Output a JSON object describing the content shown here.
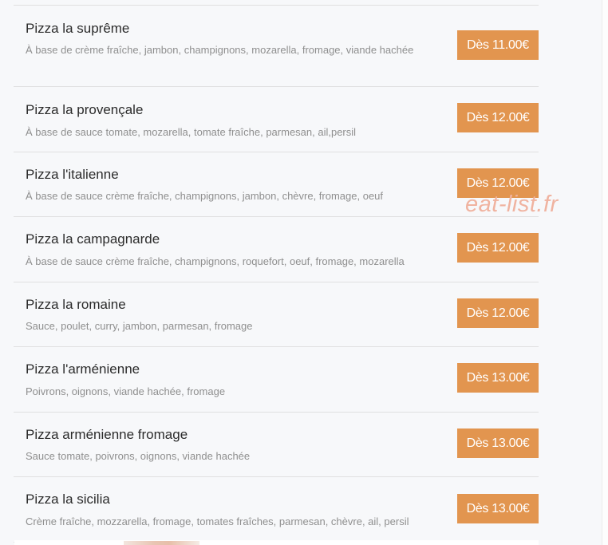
{
  "menu": {
    "items": [
      {
        "name": "Pizza la suprême",
        "description": "À base de crème fraîche, jambon, champignons, mozarella, fromage, viande hachée",
        "price": "Dès 11.00€"
      },
      {
        "name": "Pizza la provençale",
        "description": "À base de sauce tomate, mozarella, tomate fraîche, parmesan, ail,persil",
        "price": "Dès 12.00€"
      },
      {
        "name": "Pizza l'italienne",
        "description": "À base de sauce crème fraîche, champignons, jambon, chèvre, fromage, oeuf",
        "price": "Dès 12.00€"
      },
      {
        "name": "Pizza la campagnarde",
        "description": "À base de sauce crème fraîche, champignons, roquefort, oeuf, fromage, mozarella",
        "price": "Dès 12.00€"
      },
      {
        "name": "Pizza la romaine",
        "description": "Sauce, poulet, curry, jambon, parmesan, fromage",
        "price": "Dès 12.00€"
      },
      {
        "name": "Pizza l'arménienne",
        "description": "Poivrons, oignons, viande hachée, fromage",
        "price": "Dès 13.00€"
      },
      {
        "name": "Pizza arménienne fromage",
        "description": "Sauce tomate, poivrons, oignons, viande hachée",
        "price": "Dès 13.00€"
      },
      {
        "name": "Pizza la sicilia",
        "description": "Crème fraîche, mozzarella, fromage, tomates fraîches, parmesan, chèvre, ail, persil",
        "price": "Dès 13.00€"
      }
    ]
  },
  "watermark": "eat-list.fr",
  "colors": {
    "price_button_bg": "#e2954f",
    "price_button_text": "#ffffff",
    "item_name": "#2b2b2b",
    "item_description": "#8f8f8f",
    "watermark": "#f0b3a0",
    "divider": "#e0e0e0"
  }
}
